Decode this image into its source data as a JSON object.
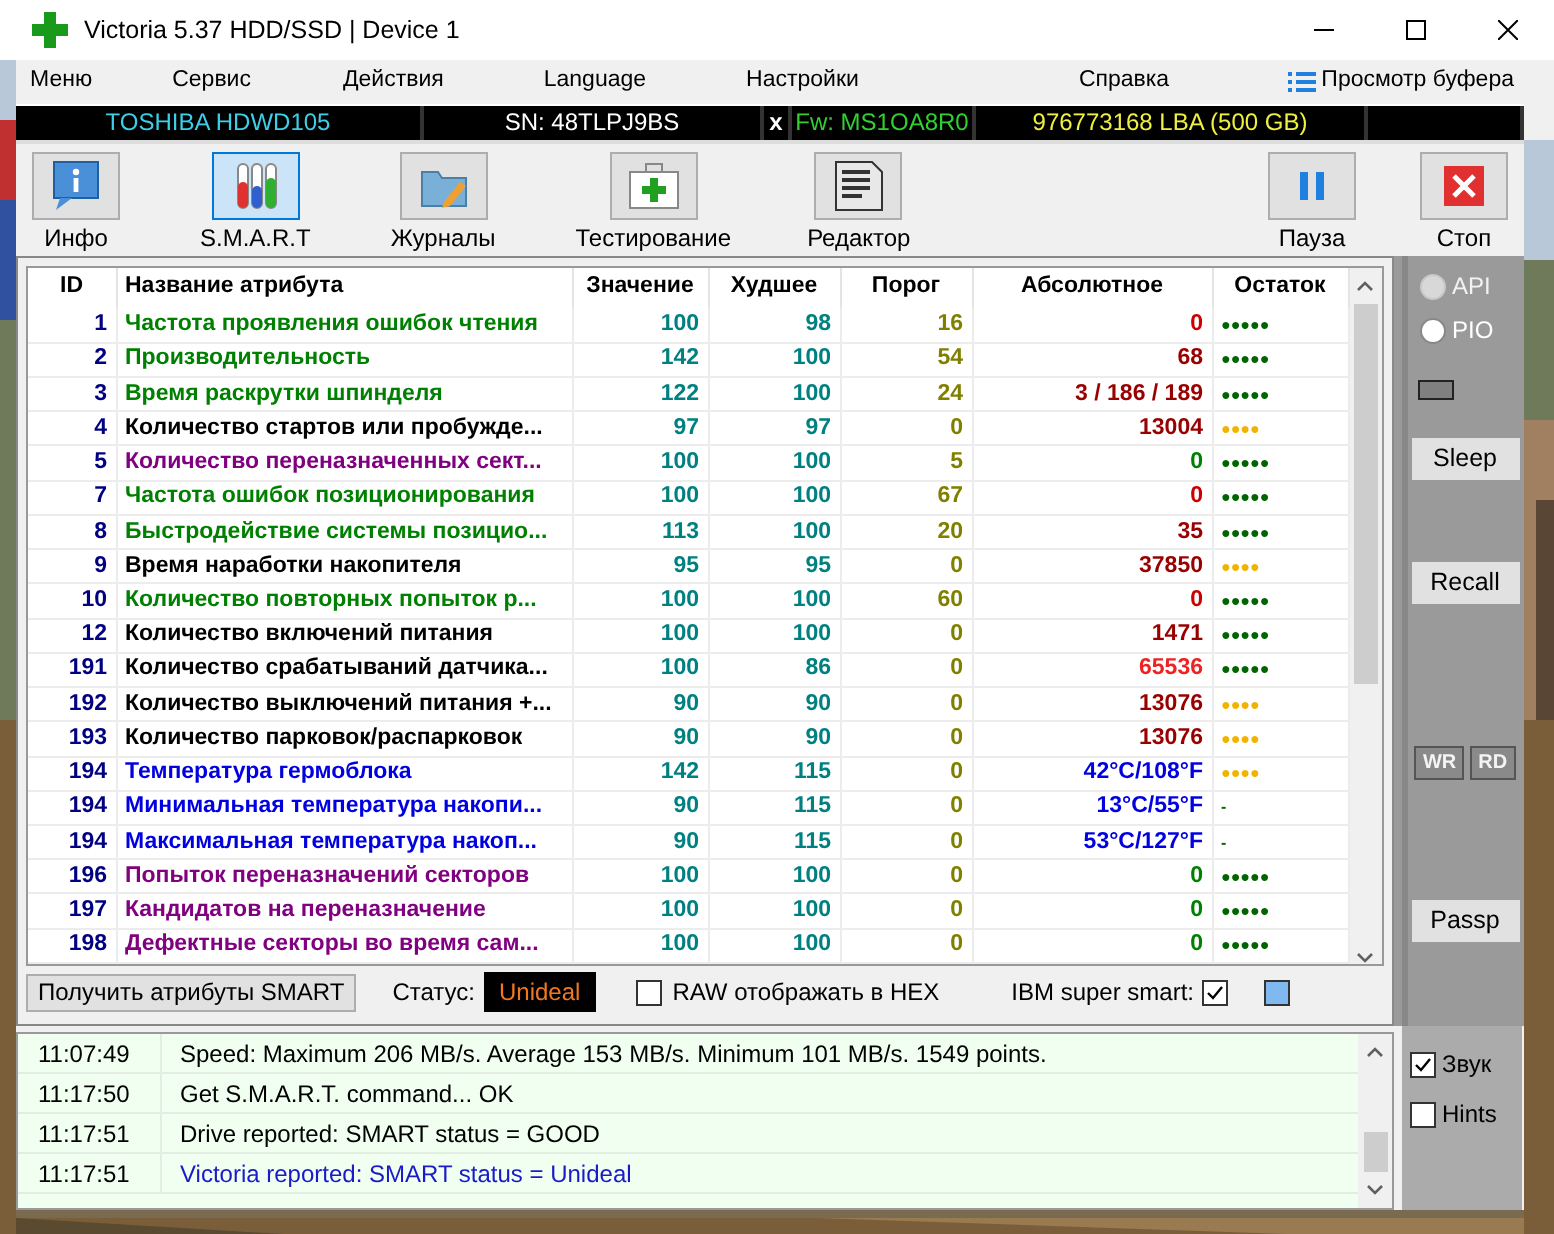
{
  "window": {
    "title": "Victoria 5.37 HDD/SSD | Device 1"
  },
  "menu": [
    "Меню",
    "Сервис",
    "Действия",
    "Language",
    "Настройки",
    "Справка"
  ],
  "buffer_view": "Просмотр буфера",
  "drive_bar": {
    "model": "TOSHIBA HDWD105",
    "serial": "SN: 48TLPJ9BS",
    "close": "x",
    "firmware": "Fw: MS1OA8R0",
    "capacity": "976773168 LBA (500 GB)"
  },
  "toolbar": [
    {
      "kind": "info",
      "label": "Инфо",
      "selected": false
    },
    {
      "kind": "smart",
      "label": "S.M.A.R.T",
      "selected": true
    },
    {
      "kind": "logs",
      "label": "Журналы",
      "selected": false
    },
    {
      "kind": "test",
      "label": "Тестирование",
      "selected": false
    },
    {
      "kind": "editor",
      "label": "Редактор",
      "selected": false
    }
  ],
  "toolbar_right": [
    {
      "kind": "pause",
      "label": "Пауза"
    },
    {
      "kind": "stop",
      "label": "Стоп"
    }
  ],
  "table": {
    "columns": [
      "ID",
      "Название атрибута",
      "Значение",
      "Худшее",
      "Порог",
      "Абсолютное",
      "Остаток"
    ],
    "rows": [
      {
        "id": "1",
        "name": "Частота проявления ошибок чтения",
        "color": "#008000",
        "value": "100",
        "worst": "98",
        "threshold": "16",
        "raw": {
          "text": "0",
          "color": "#cc0000"
        },
        "health": {
          "text": "●●●●●",
          "color": "#006400"
        }
      },
      {
        "id": "2",
        "name": "Производительность",
        "color": "#008000",
        "value": "142",
        "worst": "100",
        "threshold": "54",
        "raw": {
          "text": "68",
          "color": "#990000"
        },
        "health": {
          "text": "●●●●●",
          "color": "#006400"
        }
      },
      {
        "id": "3",
        "name": "Время раскрутки шпинделя",
        "color": "#008000",
        "value": "122",
        "worst": "100",
        "threshold": "24",
        "raw": {
          "text": "3 / 186 / 189",
          "color": "#990000"
        },
        "health": {
          "text": "●●●●●",
          "color": "#006400"
        }
      },
      {
        "id": "4",
        "name": "Количество стартов или пробужде...",
        "color": "#000000",
        "value": "97",
        "worst": "97",
        "threshold": "0",
        "raw": {
          "text": "13004",
          "color": "#990000"
        },
        "health": {
          "text": "●●●●",
          "color": "#f0b400"
        }
      },
      {
        "id": "5",
        "name": "Количество переназначенных сект...",
        "color": "#800080",
        "value": "100",
        "worst": "100",
        "threshold": "5",
        "raw": {
          "text": "0",
          "color": "#008000"
        },
        "health": {
          "text": "●●●●●",
          "color": "#006400"
        }
      },
      {
        "id": "7",
        "name": "Частота ошибок позиционирования",
        "color": "#008000",
        "value": "100",
        "worst": "100",
        "threshold": "67",
        "raw": {
          "text": "0",
          "color": "#cc0000"
        },
        "health": {
          "text": "●●●●●",
          "color": "#006400"
        }
      },
      {
        "id": "8",
        "name": "Быстродействие системы позицио...",
        "color": "#008000",
        "value": "113",
        "worst": "100",
        "threshold": "20",
        "raw": {
          "text": "35",
          "color": "#990000"
        },
        "health": {
          "text": "●●●●●",
          "color": "#006400"
        }
      },
      {
        "id": "9",
        "name": "Время наработки накопителя",
        "color": "#000000",
        "value": "95",
        "worst": "95",
        "threshold": "0",
        "raw": {
          "text": "37850",
          "color": "#990000"
        },
        "health": {
          "text": "●●●●",
          "color": "#f0b400"
        }
      },
      {
        "id": "10",
        "name": "Количество повторных попыток р...",
        "color": "#008000",
        "value": "100",
        "worst": "100",
        "threshold": "60",
        "raw": {
          "text": "0",
          "color": "#cc0000"
        },
        "health": {
          "text": "●●●●●",
          "color": "#006400"
        }
      },
      {
        "id": "12",
        "name": "Количество включений питания",
        "color": "#000000",
        "value": "100",
        "worst": "100",
        "threshold": "0",
        "raw": {
          "text": "1471",
          "color": "#990000"
        },
        "health": {
          "text": "●●●●●",
          "color": "#006400"
        }
      },
      {
        "id": "191",
        "name": "Количество срабатываний датчика...",
        "color": "#000000",
        "value": "100",
        "worst": "86",
        "threshold": "0",
        "raw": {
          "text": "65536",
          "color": "#ee2222"
        },
        "health": {
          "text": "●●●●●",
          "color": "#006400"
        }
      },
      {
        "id": "192",
        "name": "Количество выключений питания +...",
        "color": "#000000",
        "value": "90",
        "worst": "90",
        "threshold": "0",
        "raw": {
          "text": "13076",
          "color": "#990000"
        },
        "health": {
          "text": "●●●●",
          "color": "#f0b400"
        }
      },
      {
        "id": "193",
        "name": "Количество парковок/распарковок",
        "color": "#000000",
        "value": "90",
        "worst": "90",
        "threshold": "0",
        "raw": {
          "text": "13076",
          "color": "#990000"
        },
        "health": {
          "text": "●●●●",
          "color": "#f0b400"
        }
      },
      {
        "id": "194",
        "name": "Температура гермоблока",
        "color": "#0000e0",
        "value": "142",
        "worst": "115",
        "threshold": "0",
        "raw": {
          "text": "42°C/108°F",
          "color": "#0000e0"
        },
        "health": {
          "text": "●●●●",
          "color": "#f0b400"
        }
      },
      {
        "id": "194",
        "name": "Минимальная температура накопи...",
        "color": "#0000e0",
        "value": "90",
        "worst": "115",
        "threshold": "0",
        "raw": {
          "text": "13°C/55°F",
          "color": "#0000e0"
        },
        "health": {
          "text": "-",
          "color": "#006400"
        }
      },
      {
        "id": "194",
        "name": "Максимальная температура накоп...",
        "color": "#0000e0",
        "value": "90",
        "worst": "115",
        "threshold": "0",
        "raw": {
          "text": "53°C/127°F",
          "color": "#0000e0"
        },
        "health": {
          "text": "-",
          "color": "#006400"
        }
      },
      {
        "id": "196",
        "name": "Попыток переназначений секторов",
        "color": "#800080",
        "value": "100",
        "worst": "100",
        "threshold": "0",
        "raw": {
          "text": "0",
          "color": "#008000"
        },
        "health": {
          "text": "●●●●●",
          "color": "#006400"
        }
      },
      {
        "id": "197",
        "name": "Кандидатов на переназначение",
        "color": "#800080",
        "value": "100",
        "worst": "100",
        "threshold": "0",
        "raw": {
          "text": "0",
          "color": "#008000"
        },
        "health": {
          "text": "●●●●●",
          "color": "#006400"
        }
      },
      {
        "id": "198",
        "name": "Дефектные секторы во время сам...",
        "color": "#800080",
        "value": "100",
        "worst": "100",
        "threshold": "0",
        "raw": {
          "text": "0",
          "color": "#008000"
        },
        "health": {
          "text": "●●●●●",
          "color": "#006400"
        }
      }
    ]
  },
  "side_panel": {
    "modes": [
      {
        "label": "API",
        "disabled": true
      },
      {
        "label": "PIO",
        "disabled": false
      }
    ],
    "buttons": [
      "Sleep",
      "Recall"
    ],
    "indicators": [
      "WR",
      "RD"
    ],
    "passp": "Passp"
  },
  "smart_bar": {
    "get_button": "Получить атрибуты SMART",
    "status_label": "Статус:",
    "status": "Unideal",
    "raw_hex": {
      "label": "RAW отображать в HEX",
      "checked": false
    },
    "ibm": {
      "label": "IBM super smart:",
      "checked": true
    }
  },
  "log": [
    {
      "time": "11:07:49",
      "message": "Speed: Maximum 206 MB/s. Average 153 MB/s. Minimum 101 MB/s. 1549 points.",
      "kind": "normal"
    },
    {
      "time": "11:17:50",
      "message": "Get S.M.A.R.T. command... OK",
      "kind": "normal"
    },
    {
      "time": "11:17:51",
      "message": "Drive reported: SMART status = GOOD",
      "kind": "normal"
    },
    {
      "time": "11:17:51",
      "message": "Victoria reported: SMART status = Unideal",
      "kind": "info"
    }
  ],
  "options": [
    {
      "label": "Звук",
      "checked": true
    },
    {
      "label": "Hints",
      "checked": false
    }
  ]
}
